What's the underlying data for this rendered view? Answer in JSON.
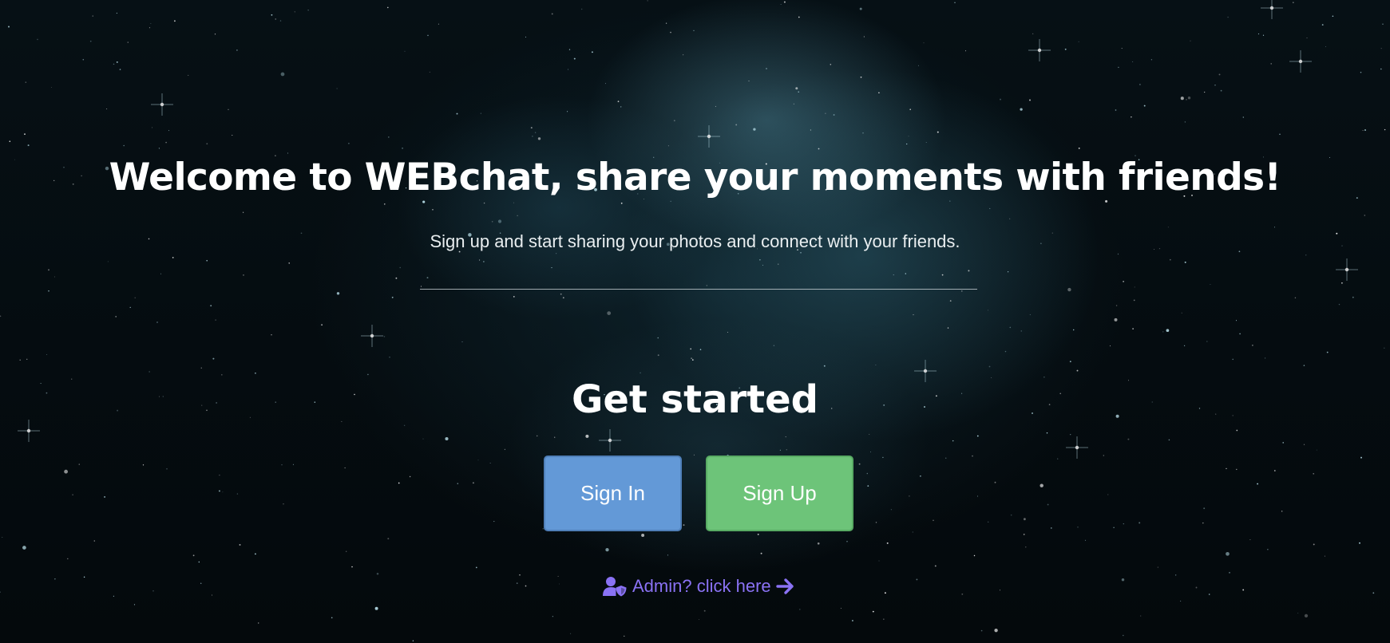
{
  "hero": {
    "title": "Welcome to WEBchat, share your moments with friends!",
    "subtitle": "Sign up and start sharing your photos and connect with your friends."
  },
  "get_started": {
    "heading": "Get started",
    "signin_label": "Sign In",
    "signup_label": "Sign Up"
  },
  "admin": {
    "link_text": "Admin? click here",
    "icon": "user-shield-icon",
    "arrow_icon": "arrow-right-icon"
  },
  "colors": {
    "signin_button": "#6399d7",
    "signup_button": "#6dc479",
    "admin_link": "#8a72f4",
    "background": "#04090c"
  }
}
